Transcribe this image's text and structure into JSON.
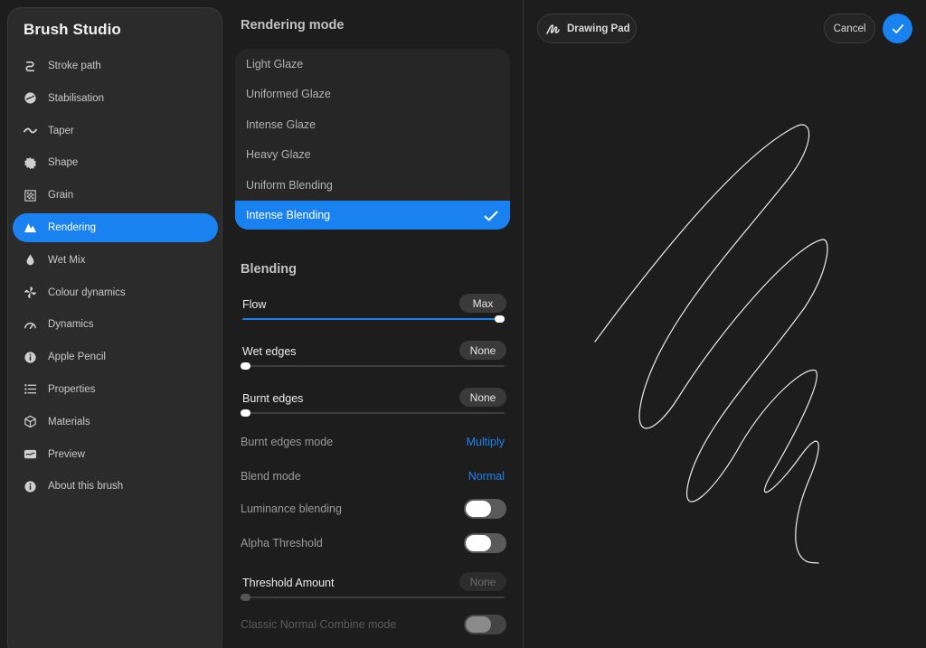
{
  "app": {
    "title": "Brush Studio"
  },
  "sidebar": {
    "active_index": 5,
    "items": [
      {
        "label": "Stroke path",
        "icon": "stroke-path-icon"
      },
      {
        "label": "Stabilisation",
        "icon": "stabilisation-icon"
      },
      {
        "label": "Taper",
        "icon": "taper-icon"
      },
      {
        "label": "Shape",
        "icon": "shape-icon"
      },
      {
        "label": "Grain",
        "icon": "grain-icon"
      },
      {
        "label": "Rendering",
        "icon": "rendering-icon"
      },
      {
        "label": "Wet Mix",
        "icon": "wet-mix-icon"
      },
      {
        "label": "Colour dynamics",
        "icon": "colour-dynamics-icon"
      },
      {
        "label": "Dynamics",
        "icon": "dynamics-icon"
      },
      {
        "label": "Apple Pencil",
        "icon": "apple-pencil-icon"
      },
      {
        "label": "Properties",
        "icon": "properties-icon"
      },
      {
        "label": "Materials",
        "icon": "materials-icon"
      },
      {
        "label": "Preview",
        "icon": "preview-icon"
      },
      {
        "label": "About this brush",
        "icon": "info-icon"
      }
    ]
  },
  "rendering_mode": {
    "title": "Rendering mode",
    "selected_index": 5,
    "options": [
      "Light Glaze",
      "Uniformed Glaze",
      "Intense Glaze",
      "Heavy Glaze",
      "Uniform Blending",
      "Intense Blending"
    ]
  },
  "blending": {
    "title": "Blending",
    "flow": {
      "label": "Flow",
      "value_text": "Max",
      "value": 1.0
    },
    "wet_edges": {
      "label": "Wet edges",
      "value_text": "None",
      "value": 0.0
    },
    "burnt_edges": {
      "label": "Burnt edges",
      "value_text": "None",
      "value": 0.0
    },
    "burnt_edges_mode": {
      "label": "Burnt edges mode",
      "value": "Multiply"
    },
    "blend_mode": {
      "label": "Blend mode",
      "value": "Normal"
    },
    "luminance_blending": {
      "label": "Luminance blending",
      "on": false
    },
    "alpha_threshold": {
      "label": "Alpha Threshold",
      "on": false
    },
    "threshold_amount": {
      "label": "Threshold Amount",
      "value_text": "None",
      "value": 0.0,
      "enabled": false
    },
    "classic_normal_combine": {
      "label": "Classic Normal Combine mode",
      "on": false,
      "enabled": false
    }
  },
  "pad": {
    "drawing_pad_label": "Drawing Pad",
    "cancel_label": "Cancel",
    "done_icon": "checkmark-icon",
    "accent_color": "#1a82f0"
  }
}
